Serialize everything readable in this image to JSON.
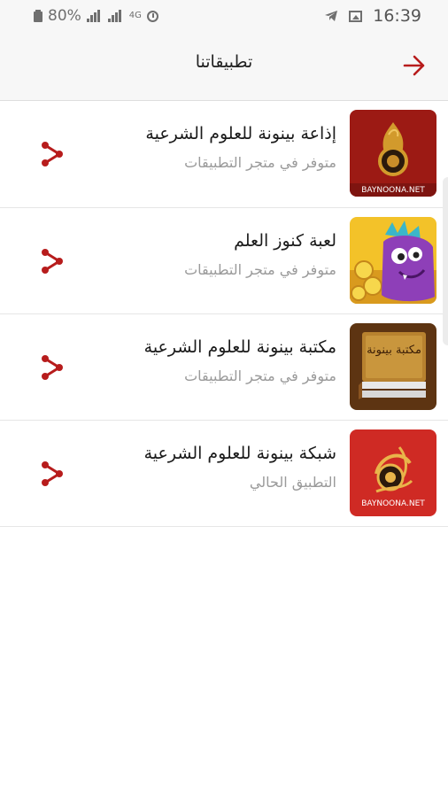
{
  "status_bar": {
    "battery": "80%",
    "time": "16:39",
    "network": "4G",
    "icons": [
      "battery-icon",
      "signal-icon",
      "signal-icon",
      "network-4g-icon",
      "alarm-icon",
      "telegram-icon",
      "image-icon"
    ]
  },
  "header": {
    "title": "تطبيقاتنا",
    "back_icon": "arrow-right-icon",
    "accent": "#b71c1c"
  },
  "apps": [
    {
      "title": "إذاعة بينونة للعلوم الشرعية",
      "subtitle": "متوفر في متجر التطبيقات",
      "icon": "radio-app-icon",
      "icon_text": "BAYNOONA.NET",
      "share_icon": "share-icon"
    },
    {
      "title": "لعبة كنوز العلم",
      "subtitle": "متوفر في متجر التطبيقات",
      "icon": "game-app-icon",
      "share_icon": "share-icon"
    },
    {
      "title": "مكتبة بينونة للعلوم الشرعية",
      "subtitle": "متوفر في متجر التطبيقات",
      "icon": "library-app-icon",
      "icon_text": "مكتبة بينونة",
      "share_icon": "share-icon"
    },
    {
      "title": "شبكة بينونة للعلوم الشرعية",
      "subtitle": "التطبيق الحالي",
      "icon": "network-app-icon",
      "icon_text": "BAYNOONA.NET",
      "share_icon": "share-icon"
    }
  ]
}
